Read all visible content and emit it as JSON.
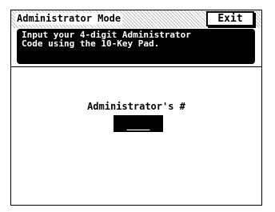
{
  "window": {
    "title": "Administrator Mode",
    "exit_label": "Exit"
  },
  "message": {
    "line1": "Input your 4-digit Administrator",
    "line2": "Code using the 10-Key Pad."
  },
  "admin_code": {
    "label": "Administrator's #",
    "value": "____"
  },
  "colors": {
    "message_background": "#000000",
    "message_text": "#ffffff",
    "field_background": "#000000"
  }
}
